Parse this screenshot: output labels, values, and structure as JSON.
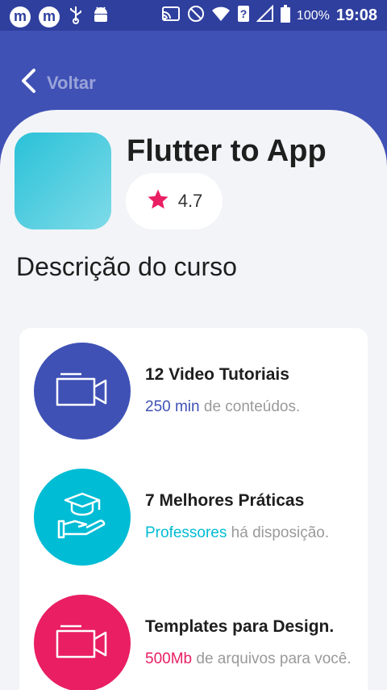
{
  "status_bar": {
    "battery": "100%",
    "time": "19:08"
  },
  "header": {
    "back_label": "Voltar"
  },
  "course": {
    "title": "Flutter to App",
    "rating": "4.7",
    "section_title": "Descrição do curso"
  },
  "features": [
    {
      "title": "12 Video Tutoriais",
      "highlight": "250 min",
      "rest": " de conteúdos.",
      "color": "#3f51b5",
      "icon": "video-camera-icon"
    },
    {
      "title": "7 Melhores Práticas",
      "highlight": "Professores",
      "rest": " há disposição.",
      "color": "#00bcd4",
      "icon": "graduation-hand-icon"
    },
    {
      "title": "Templates para Design.",
      "highlight": "500Mb",
      "rest": " de arquivos para você.",
      "color": "#e91e63",
      "icon": "video-camera-icon"
    }
  ],
  "colors": {
    "primary": "#3f51b5",
    "cyan": "#00bcd4",
    "pink": "#e91e63",
    "background": "#f3f4f8"
  }
}
